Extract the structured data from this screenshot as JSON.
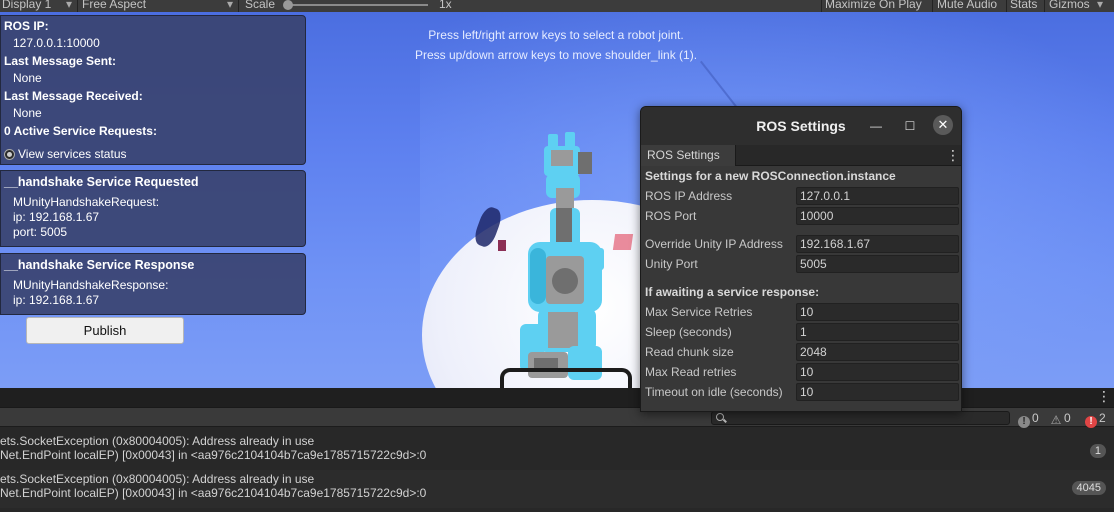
{
  "toolbar": {
    "display": "Display 1",
    "aspect": "Free Aspect",
    "scale_label": "Scale",
    "scale_value": "1x",
    "scale_level": 0.0,
    "maximize": "Maximize On Play",
    "mute": "Mute Audio",
    "stats": "Stats",
    "gizmos": "Gizmos"
  },
  "hints": {
    "line1": "Press left/right arrow keys to select a robot joint.",
    "line2": "Press up/down arrow keys to move shoulder_link (1)."
  },
  "status_panel": {
    "ip_label": "ROS IP:",
    "ip_value": "127.0.0.1:10000",
    "sent_label": "Last Message Sent:",
    "sent_value": "None",
    "received_label": "Last Message Received:",
    "received_value": "None",
    "active_label": "0 Active Service Requests:",
    "view_status": "View services status"
  },
  "request_panel": {
    "title": "__handshake Service Requested",
    "line1": "MUnityHandshakeRequest:",
    "line2": "ip: 192.168.1.67",
    "line3": "port: 5005"
  },
  "response_panel": {
    "title": "__handshake Service Response",
    "line1": "MUnityHandshakeResponse:",
    "line2": "ip: 192.168.1.67"
  },
  "publish_button": "Publish",
  "ros_settings": {
    "window_title": "ROS Settings",
    "tab": "ROS Settings",
    "section1": "Settings for a new ROSConnection.instance",
    "ros_ip_label": "ROS IP Address",
    "ros_ip_value": "127.0.0.1",
    "ros_port_label": "ROS Port",
    "ros_port_value": "10000",
    "override_ip_label": "Override Unity IP Address",
    "override_ip_value": "192.168.1.67",
    "unity_port_label": "Unity Port",
    "unity_port_value": "5005",
    "section2": "If awaiting a service response:",
    "max_retries_label": "Max Service Retries",
    "max_retries_value": "10",
    "sleep_label": "Sleep (seconds)",
    "sleep_value": "1",
    "chunk_label": "Read chunk size",
    "chunk_value": "2048",
    "read_retries_label": "Max Read retries",
    "read_retries_value": "10",
    "timeout_label": "Timeout on idle (seconds)",
    "timeout_value": "10"
  },
  "console": {
    "info_count": "0",
    "warn_count": "0",
    "error_count": "2",
    "logs": [
      {
        "line1": "ets.SocketException (0x80004005): Address already in use",
        "line2": "Net.EndPoint localEP) [0x00043] in <aa976c2104104b7ca9e1785715722c9d>:0",
        "count": "1"
      },
      {
        "line1": "ets.SocketException (0x80004005): Address already in use",
        "line2": "Net.EndPoint localEP) [0x00043] in <aa976c2104104b7ca9e1785715722c9d>:0",
        "count": "4045"
      }
    ]
  },
  "colors": {
    "panel_bg": "#3a4370",
    "sky": "#6f92f5",
    "robot": "#5ed0f2",
    "error": "#e04545"
  }
}
